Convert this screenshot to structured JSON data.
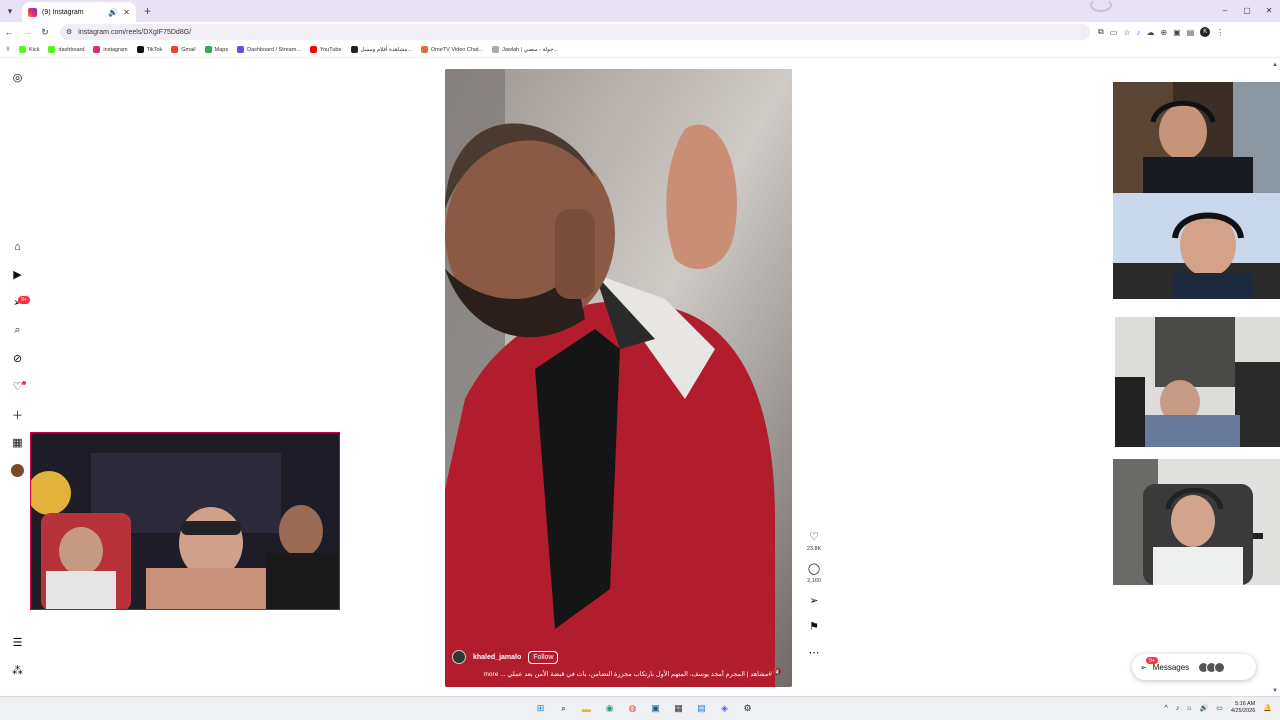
{
  "browser": {
    "tab_title": "(9) Instagram",
    "new_tab": "+",
    "url": "instagram.com/reels/DXgIF75Dd8G/",
    "window_controls": [
      "–",
      "▢",
      "✕"
    ],
    "bookmarks": [
      {
        "label": "Kick",
        "color": "#53fc18"
      },
      {
        "label": "dashboard",
        "color": "#53fc18"
      },
      {
        "label": "instagram",
        "color": "#dd2a7b"
      },
      {
        "label": "TikTok",
        "color": "#111111"
      },
      {
        "label": "Gmail",
        "color": "#ea4335"
      },
      {
        "label": "Maps",
        "color": "#34a853"
      },
      {
        "label": "Dashboard / Stream...",
        "color": "#6b4ae8"
      },
      {
        "label": "YouTube",
        "color": "#ff0000"
      },
      {
        "label": "مشاهدة أفلام ومسل...",
        "color": "#222222"
      },
      {
        "label": "OmeTV Video Chat...",
        "color": "#e06b4a"
      },
      {
        "label": "Jawlah | جولة - منصي...",
        "color": "#aaaaaa"
      }
    ]
  },
  "nav": {
    "notifications_badge": "9+"
  },
  "reel": {
    "author": "khaled_jamalo",
    "follow_label": "Follow",
    "caption": "#مشاهد | المجرم أمجد يوسف، المتهم الأول بارتكاب مجزرة التضامن، بات في قبضة الأمن بعد عملي ... more",
    "likes": "23.8K",
    "comments": "2,160"
  },
  "messages": {
    "label": "Messages",
    "badge": "9+"
  },
  "taskbar": {
    "time": "5:16 AM",
    "date": "4/25/2026"
  }
}
